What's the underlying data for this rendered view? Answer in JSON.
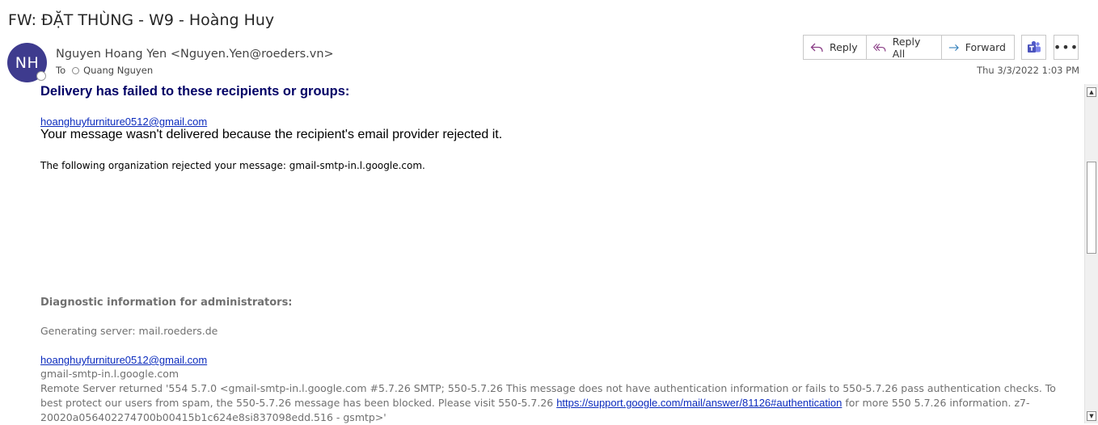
{
  "message": {
    "subject": "FW: ĐẶT THÙNG - W9 - Hoàng Huy",
    "avatar_initials": "NH",
    "sender": "Nguyen Hoang Yen <Nguyen.Yen@roeders.vn>",
    "to_label": "To",
    "to_recipient": "Quang Nguyen",
    "date": "Thu 3/3/2022 1:03 PM"
  },
  "actions": {
    "reply_label": "Reply",
    "reply_all_label": "Reply All",
    "forward_label": "Forward",
    "teams_icon": "teams-icon",
    "more_label": "•••"
  },
  "body": {
    "heading": "Delivery has failed to these recipients or groups:",
    "recipient_email": "hoanghuyfurniture0512@gmail.com",
    "reason": "Your message wasn't delivered because the recipient's email provider rejected it.",
    "org_rejected": "The following organization rejected your message: gmail-smtp-in.l.google.com.",
    "diag_heading": "Diagnostic information for administrators:",
    "generating_server": "Generating server: mail.roeders.de",
    "recipient_email_2": "hoanghuyfurniture0512@gmail.com",
    "server_host": "gmail-smtp-in.l.google.com",
    "remote_part1": "Remote Server returned '554 5.7.0 <gmail-smtp-in.l.google.com #5.7.26 SMTP; 550-5.7.26 This message does not have authentication information or fails to 550-5.7.26 pass authentication checks. To best protect our users from spam, the 550-5.7.26 message has been blocked. Please visit 550-5.7.26 ",
    "remote_link": "https://support.google.com/mail/answer/81126#authentication",
    "remote_part2": " for more 550 5.7.26 information. z7-20020a056402274700b00415b1c624e8si837098edd.516 - gsmtp>'"
  },
  "colors": {
    "avatar_bg": "#3e3b8e",
    "heading": "#000066",
    "link": "#0b2bbd",
    "diag_text": "#707070"
  }
}
